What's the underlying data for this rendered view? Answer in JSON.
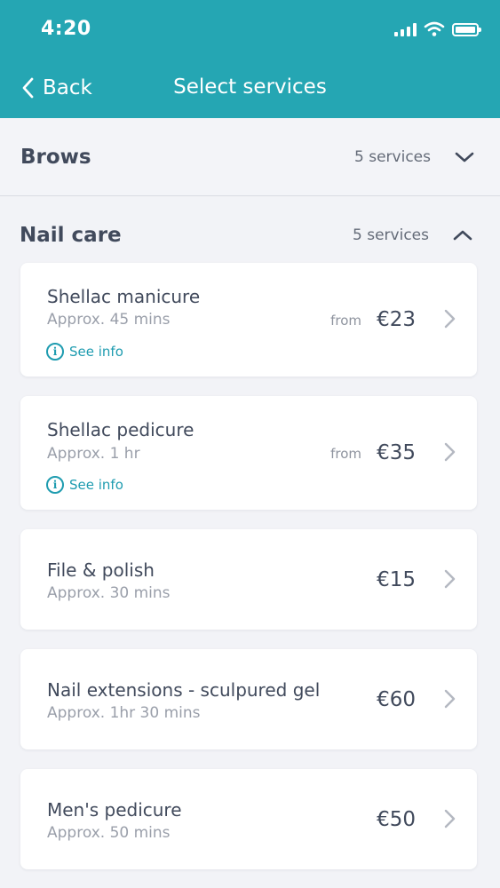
{
  "status_bar": {
    "time": "4:20"
  },
  "nav": {
    "back_label": "Back",
    "title": "Select services"
  },
  "sections": [
    {
      "title": "Brows",
      "count": "5 services",
      "expanded": false
    },
    {
      "title": "Nail care",
      "count": "5 services",
      "expanded": true
    }
  ],
  "services": [
    {
      "name": "Shellac manicure",
      "duration": "Approx. 45 mins",
      "from_label": "from",
      "price": "€23",
      "info_label": "See info"
    },
    {
      "name": "Shellac pedicure",
      "duration": "Approx. 1 hr",
      "from_label": "from",
      "price": "€35",
      "info_label": "See info"
    },
    {
      "name": "File & polish",
      "duration": "Approx. 30 mins",
      "price": "€15"
    },
    {
      "name": "Nail extensions - sculpured gel",
      "duration": "Approx. 1hr 30 mins",
      "price": "€60"
    },
    {
      "name": "Men's pedicure",
      "duration": "Approx. 50 mins",
      "price": "€50"
    }
  ],
  "colors": {
    "header": "#25a6b3",
    "accent": "#1f9cb0",
    "background": "#f2f3f7"
  },
  "icons": [
    "signal-icon",
    "wifi-icon",
    "battery-icon",
    "back-chevron-icon",
    "chevron-down-icon",
    "chevron-up-icon",
    "info-icon",
    "chevron-right-icon"
  ]
}
